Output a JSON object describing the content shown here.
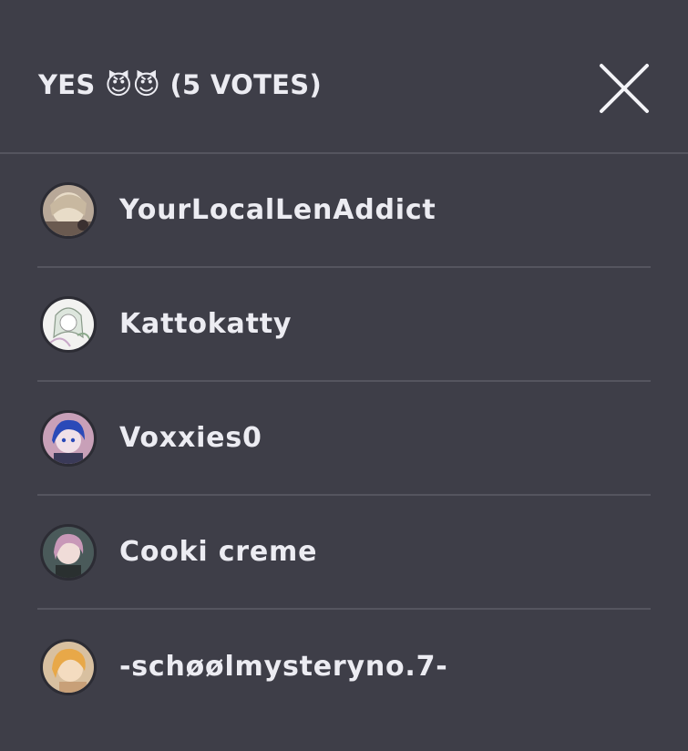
{
  "header": {
    "title": "YES 😈😈 (5 VOTES)"
  },
  "voters": [
    {
      "name": "YourLocalLenAddict",
      "avatar_icon": "avatar-blonde-character",
      "colors": [
        "#c8b8a0",
        "#8a7a6a",
        "#e8dcc8"
      ]
    },
    {
      "name": "Kattokatty",
      "avatar_icon": "avatar-white-haired-sketch",
      "colors": [
        "#f2f2f0",
        "#9aa89a",
        "#d8c8d8"
      ]
    },
    {
      "name": "Voxxies0",
      "avatar_icon": "avatar-blue-haired-character",
      "colors": [
        "#2a4ab8",
        "#e8d8e8",
        "#c87a9a"
      ]
    },
    {
      "name": "Cooki creme",
      "avatar_icon": "avatar-pink-haired-character",
      "colors": [
        "#c898b8",
        "#5a6a6a",
        "#3a4a4a"
      ]
    },
    {
      "name": "-schøølmysteryno.7-",
      "avatar_icon": "avatar-orange-haired-character",
      "colors": [
        "#e8a848",
        "#d8b890",
        "#f0d8a8"
      ]
    }
  ]
}
